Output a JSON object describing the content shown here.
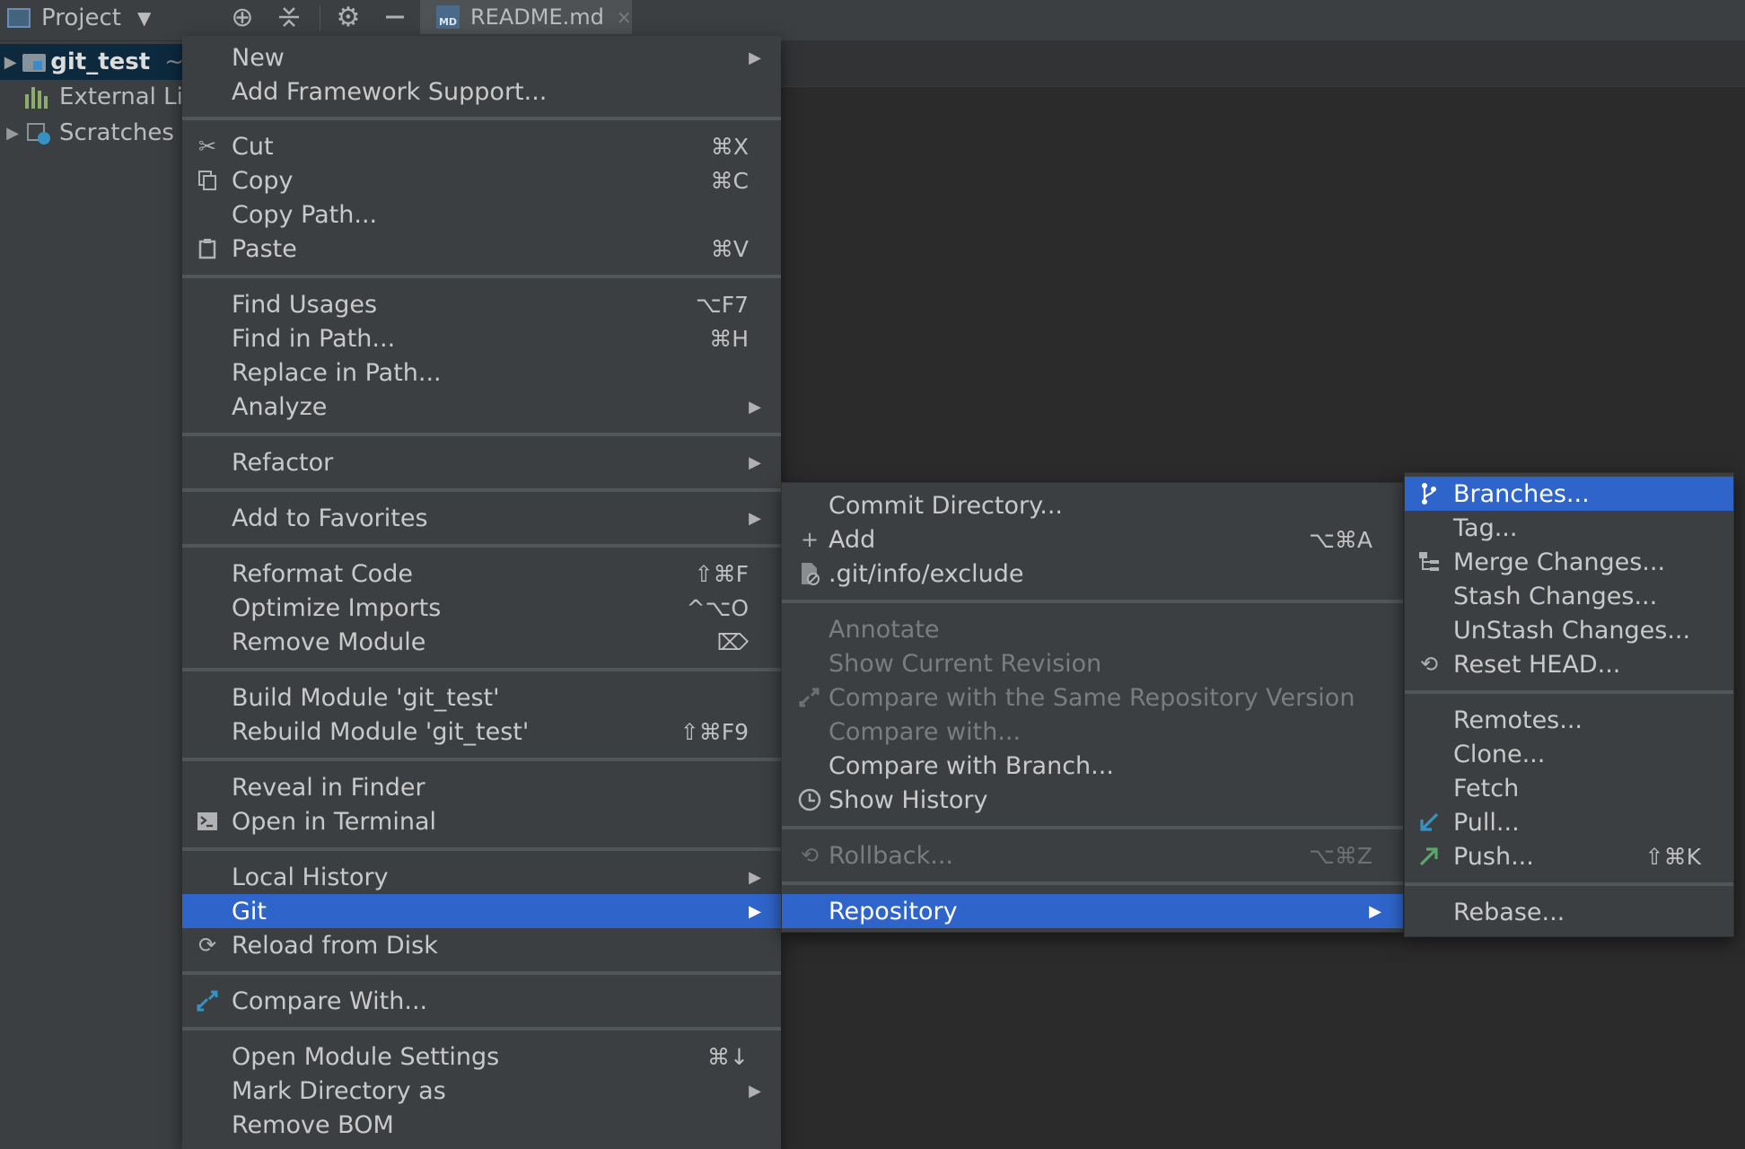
{
  "toolbar": {
    "project_label": "Project",
    "icons": [
      "locate-icon",
      "collapse-icon",
      "gear-icon",
      "minimize-icon"
    ],
    "tab": {
      "icon_text": "MD",
      "label": "README.md",
      "close": "×"
    }
  },
  "tree": {
    "items": [
      {
        "label": "git_test",
        "suffix": "~",
        "arrow": "▶"
      },
      {
        "label": "External Li",
        "arrow": ""
      },
      {
        "label": "Scratches",
        "arrow": "▶"
      }
    ]
  },
  "main_menu": {
    "items": [
      {
        "label": "New",
        "submenu": true
      },
      {
        "label": "Add Framework Support..."
      },
      {
        "label": "Cut",
        "shortcut": "⌘X",
        "icon": "scissors-icon"
      },
      {
        "label": "Copy",
        "shortcut": "⌘C",
        "icon": "copy-icon"
      },
      {
        "label": "Copy Path..."
      },
      {
        "label": "Paste",
        "shortcut": "⌘V",
        "icon": "clipboard-icon"
      },
      {
        "label": "Find Usages",
        "shortcut": "⌥F7"
      },
      {
        "label": "Find in Path...",
        "shortcut": "⌘H"
      },
      {
        "label": "Replace in Path..."
      },
      {
        "label": "Analyze",
        "submenu": true
      },
      {
        "label": "Refactor",
        "submenu": true
      },
      {
        "label": "Add to Favorites",
        "submenu": true
      },
      {
        "label": "Reformat Code",
        "shortcut": "⇧⌘F"
      },
      {
        "label": "Optimize Imports",
        "shortcut": "^⌥O"
      },
      {
        "label": "Remove Module",
        "shortcut": "⌦"
      },
      {
        "label": "Build Module 'git_test'"
      },
      {
        "label": "Rebuild Module 'git_test'",
        "shortcut": "⇧⌘F9"
      },
      {
        "label": "Reveal in Finder"
      },
      {
        "label": "Open in Terminal",
        "icon": "terminal-icon"
      },
      {
        "label": "Local History",
        "submenu": true
      },
      {
        "label": "Git",
        "submenu": true,
        "selected": true
      },
      {
        "label": "Reload from Disk",
        "icon": "reload-icon"
      },
      {
        "label": "Compare With...",
        "icon": "compare-icon"
      },
      {
        "label": "Open Module Settings",
        "shortcut": "⌘↓"
      },
      {
        "label": "Mark Directory as",
        "submenu": true
      },
      {
        "label": "Remove BOM"
      }
    ]
  },
  "git_menu": {
    "items": [
      {
        "label": "Commit Directory..."
      },
      {
        "label": "Add",
        "shortcut": "⌥⌘A",
        "icon": "plus-icon"
      },
      {
        "label": ".git/info/exclude",
        "icon": "exclude-file-icon"
      },
      {
        "label": "Annotate",
        "disabled": true
      },
      {
        "label": "Show Current Revision",
        "disabled": true
      },
      {
        "label": "Compare with the Same Repository Version",
        "disabled": true,
        "icon": "compare-icon"
      },
      {
        "label": "Compare with...",
        "disabled": true
      },
      {
        "label": "Compare with Branch..."
      },
      {
        "label": "Show History",
        "icon": "clock-icon"
      },
      {
        "label": "Rollback...",
        "shortcut": "⌥⌘Z",
        "disabled": true,
        "icon": "undo-icon"
      },
      {
        "label": "Repository",
        "submenu": true,
        "selected": true
      }
    ]
  },
  "repo_menu": {
    "items": [
      {
        "label": "Branches...",
        "selected": true,
        "icon": "branch-icon"
      },
      {
        "label": "Tag..."
      },
      {
        "label": "Merge Changes...",
        "icon": "merge-icon"
      },
      {
        "label": "Stash Changes..."
      },
      {
        "label": "UnStash Changes..."
      },
      {
        "label": "Reset HEAD...",
        "icon": "reset-icon"
      },
      {
        "label": "Remotes..."
      },
      {
        "label": "Clone..."
      },
      {
        "label": "Fetch"
      },
      {
        "label": "Pull...",
        "icon": "pull-arrow-icon"
      },
      {
        "label": "Push...",
        "shortcut": "⇧⌘K",
        "icon": "push-arrow-icon"
      },
      {
        "label": "Rebase..."
      }
    ]
  },
  "glyphs": {
    "submenu_arrow": "▶"
  },
  "colors": {
    "selection": "#2f65ca",
    "menu_bg": "#3c3f41",
    "pull": "#3592c4",
    "push": "#59a869"
  }
}
